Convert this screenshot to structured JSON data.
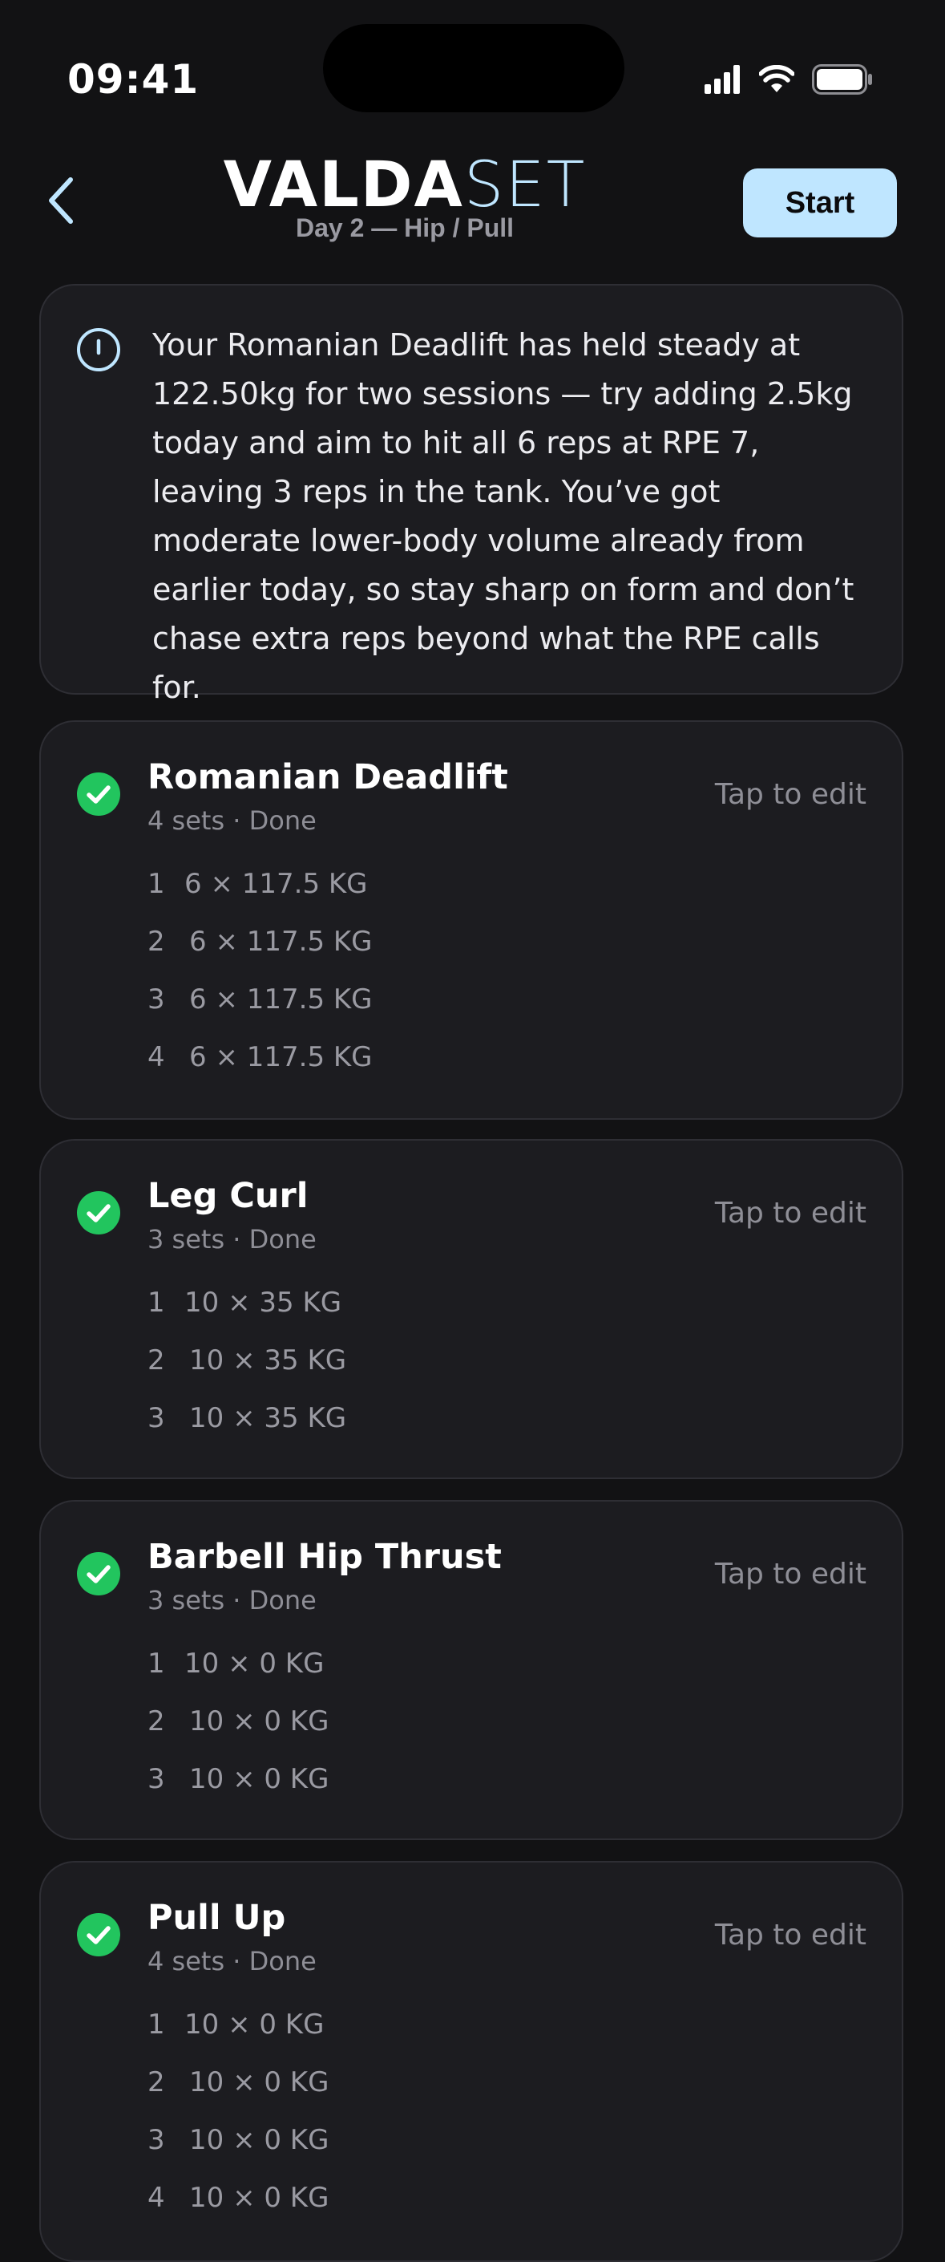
{
  "status_bar": {
    "time": "09:41",
    "icons": [
      "cellular-signal-icon",
      "wifi-icon",
      "battery-icon"
    ]
  },
  "header": {
    "back_icon": "chevron-left-icon",
    "logo_part1": "VALDA",
    "logo_part2": "SET",
    "subtitle": "Day 2 — Hip / Pull",
    "start_label": "Start"
  },
  "insight": {
    "icon": "info-icon",
    "text": "Your Romanian Deadlift has held steady at 122.50kg for two sessions — try adding 2.5kg today and aim to hit all 6 reps at RPE 7, leaving 3 reps in the tank. You’ve got moderate lower-body volume already from earlier today, so stay sharp on form and don’t chase extra reps beyond what the RPE calls for."
  },
  "colors": {
    "accent": "#bfe6ff",
    "done_green": "#22c55e",
    "card_bg": "#1c1c20",
    "page_bg": "#121214"
  },
  "exercises": [
    {
      "name": "Romanian Deadlift",
      "meta": "4 sets · Done",
      "edit_label": "Tap to edit",
      "sets": [
        {
          "num": "1",
          "detail": "6 × 117.5 KG"
        },
        {
          "num": "2",
          "detail": "6 × 117.5 KG"
        },
        {
          "num": "3",
          "detail": "6 × 117.5 KG"
        },
        {
          "num": "4",
          "detail": "6 × 117.5 KG"
        }
      ]
    },
    {
      "name": "Leg Curl",
      "meta": "3 sets · Done",
      "edit_label": "Tap to edit",
      "sets": [
        {
          "num": "1",
          "detail": "10 × 35 KG"
        },
        {
          "num": "2",
          "detail": "10 × 35 KG"
        },
        {
          "num": "3",
          "detail": "10 × 35 KG"
        }
      ]
    },
    {
      "name": "Barbell Hip Thrust",
      "meta": "3 sets · Done",
      "edit_label": "Tap to edit",
      "sets": [
        {
          "num": "1",
          "detail": "10 × 0 KG"
        },
        {
          "num": "2",
          "detail": "10 × 0 KG"
        },
        {
          "num": "3",
          "detail": "10 × 0 KG"
        }
      ]
    },
    {
      "name": "Pull Up",
      "meta": "4 sets · Done",
      "edit_label": "Tap to edit",
      "sets": [
        {
          "num": "1",
          "detail": "10 × 0 KG"
        },
        {
          "num": "2",
          "detail": "10 × 0 KG"
        },
        {
          "num": "3",
          "detail": "10 × 0 KG"
        },
        {
          "num": "4",
          "detail": "10 × 0 KG"
        }
      ]
    }
  ]
}
